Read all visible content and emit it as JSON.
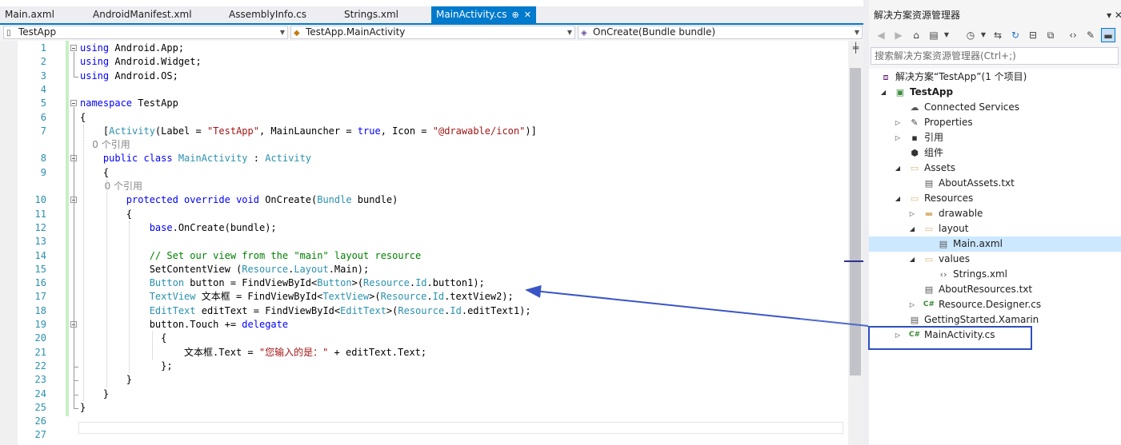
{
  "tabs": [
    {
      "label": "Main.axml",
      "active": false
    },
    {
      "label": "AndroidManifest.xml",
      "active": false
    },
    {
      "label": "AssemblyInfo.cs",
      "active": false
    },
    {
      "label": "Strings.xml",
      "active": false
    },
    {
      "label": "MainActivity.cs",
      "active": true
    }
  ],
  "active_tab_pin": "⊕",
  "active_tab_close": "✕",
  "nav": {
    "project": "TestApp",
    "class": "TestApp.MainActivity",
    "member": "OnCreate(Bundle bundle)"
  },
  "line_numbers": [
    "1",
    "2",
    "3",
    "4",
    "5",
    "6",
    "7",
    "8",
    "9",
    "10",
    "11",
    "12",
    "13",
    "14",
    "15",
    "16",
    "17",
    "18",
    "19",
    "20",
    "21",
    "22",
    "23",
    "24",
    "25",
    "26",
    "27"
  ],
  "code_lines": [
    "using Android.App;",
    "using Android.Widget;",
    "using Android.OS;",
    "",
    "namespace TestApp",
    "{",
    "    [Activity(Label = \"TestApp\", MainLauncher = true, Icon = \"@drawable/icon\")]",
    "    0 个引用",
    "    public class MainActivity : Activity",
    "    {",
    "        0 个引用",
    "        protected override void OnCreate(Bundle bundle)",
    "        {",
    "            base.OnCreate(bundle);",
    "",
    "            // Set our view from the \"main\" layout resource",
    "            SetContentView (Resource.Layout.Main);",
    "            Button button = FindViewById<Button>(Resource.Id.button1);",
    "            TextView 文本框 = FindViewById<TextView>(Resource.Id.textView2);",
    "            EditText editText = FindViewById<EditText>(Resource.Id.editText1);",
    "            button.Touch += delegate",
    "              {",
    "                  文本框.Text = \"您输入的是：\" + editText.Text;",
    "              };",
    "        }",
    "    }",
    "}",
    "",
    ""
  ],
  "solution_explorer": {
    "title": "解决方案资源管理器",
    "search_placeholder": "搜索解决方案资源管理器(Ctrl+;)",
    "items": [
      {
        "label": "解决方案“TestApp”(1 个项目)",
        "icon": "solution-icon",
        "bold": false
      },
      {
        "label": "TestApp",
        "icon": "android-project-icon",
        "bold": true
      },
      {
        "label": "Connected Services",
        "icon": "cloud-icon",
        "bold": false
      },
      {
        "label": "Properties",
        "icon": "wrench-icon",
        "bold": false
      },
      {
        "label": "引用",
        "icon": "references-icon",
        "bold": false
      },
      {
        "label": "组件",
        "icon": "components-icon",
        "bold": false
      },
      {
        "label": "Assets",
        "icon": "folder-icon",
        "bold": false
      },
      {
        "label": "AboutAssets.txt",
        "icon": "text-file-icon",
        "bold": false
      },
      {
        "label": "Resources",
        "icon": "folder-icon",
        "bold": false
      },
      {
        "label": "drawable",
        "icon": "folder-icon",
        "bold": false
      },
      {
        "label": "layout",
        "icon": "folder-icon",
        "bold": false
      },
      {
        "label": "Main.axml",
        "icon": "layout-file-icon",
        "bold": false
      },
      {
        "label": "values",
        "icon": "folder-icon",
        "bold": false
      },
      {
        "label": "Strings.xml",
        "icon": "xml-file-icon",
        "bold": false
      },
      {
        "label": "AboutResources.txt",
        "icon": "text-file-icon",
        "bold": false
      },
      {
        "label": "Resource.Designer.cs",
        "icon": "csharp-file-icon",
        "bold": false
      },
      {
        "label": "GettingStarted.Xamarin",
        "icon": "text-file-icon",
        "bold": false
      },
      {
        "label": "MainActivity.cs",
        "icon": "csharp-file-icon",
        "bold": false
      }
    ]
  },
  "colors": {
    "accent": "#007acc",
    "keyword": "#0000ff",
    "type": "#2b91af",
    "string": "#a31515",
    "comment": "#008000",
    "annotation": "#2e4fc0",
    "selection": "#cce8ff"
  }
}
